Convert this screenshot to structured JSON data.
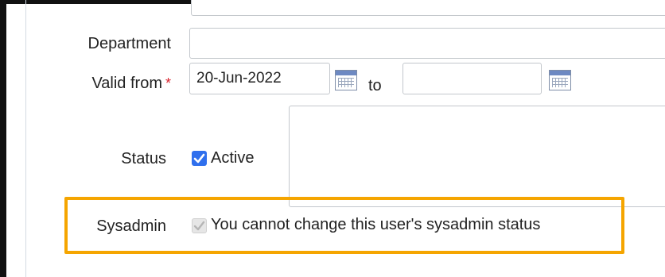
{
  "form": {
    "department_label": "Department",
    "department_value": "",
    "valid_from_label": "Valid from",
    "required_marker": "*",
    "valid_from_value": "20-Jun-2022",
    "to_label": "to",
    "valid_to_value": "",
    "status_label": "Status",
    "active_label": "Active",
    "active_checked": true,
    "sysadmin_label": "Sysadmin",
    "sysadmin_checked": true,
    "sysadmin_note": "You cannot change this user's sysadmin status"
  },
  "icons": {
    "calendar": "calendar-icon",
    "checkmark": "checkmark-icon"
  },
  "colors": {
    "highlight_border": "#f5a500",
    "checkbox_active": "#2f6fed",
    "required": "#d9232d"
  }
}
